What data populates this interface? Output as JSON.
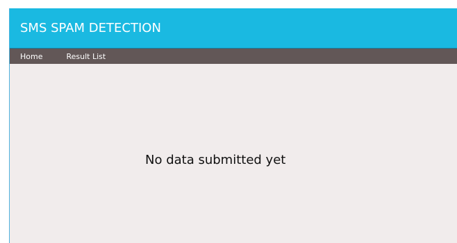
{
  "header": {
    "title": "SMS SPAM DETECTION",
    "background_color": "#1ab9e1"
  },
  "nav": {
    "background_color": "#625757",
    "items": [
      {
        "label": "Home"
      },
      {
        "label": "Result List"
      }
    ]
  },
  "main": {
    "message": "No data submitted yet",
    "background_color": "#f1ecec"
  }
}
